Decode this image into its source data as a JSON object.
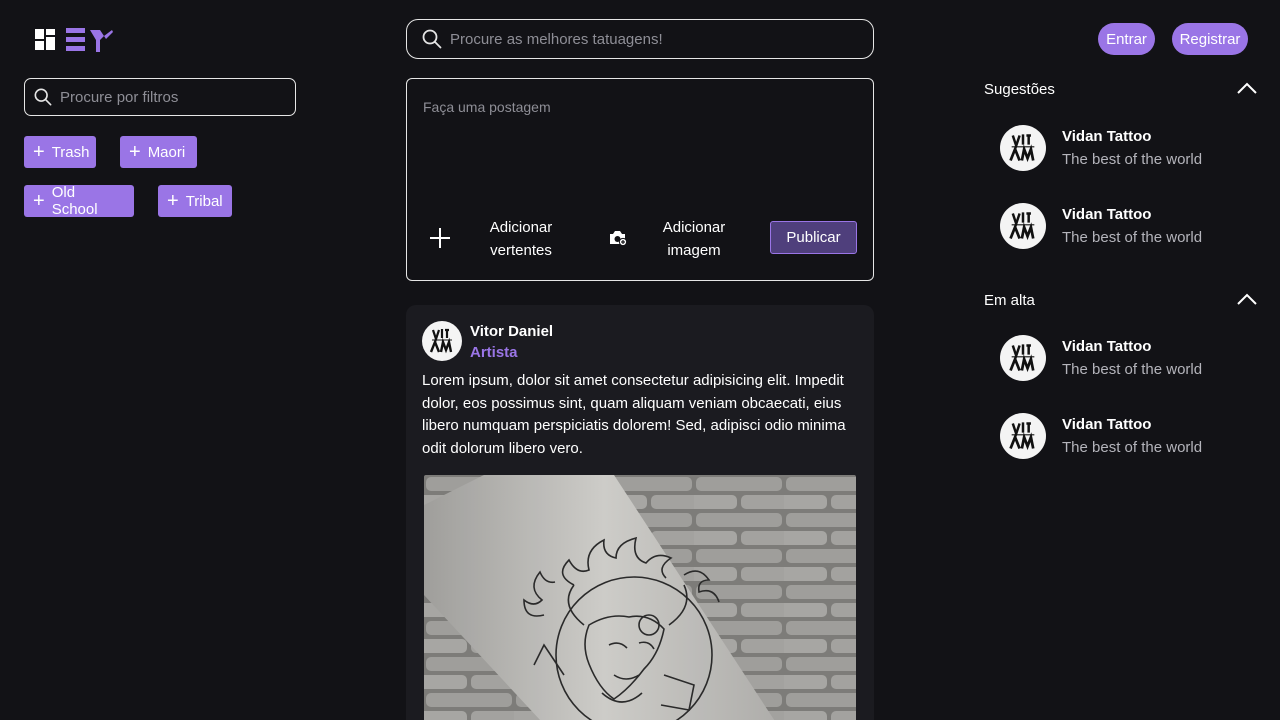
{
  "header": {
    "search_placeholder": "Procure as melhores tatuagens!",
    "login_label": "Entrar",
    "register_label": "Registrar"
  },
  "filters": {
    "search_placeholder": "Procure por filtros",
    "tags": [
      "Trash",
      "Maori",
      "Old School",
      "Tribal"
    ]
  },
  "composer": {
    "placeholder": "Faça uma postagem",
    "add_styles_label": "Adicionar\nvertentes",
    "add_image_label": "Adicionar\nimagem",
    "publish_label": "Publicar"
  },
  "post": {
    "author": "Vitor Daniel",
    "role": "Artista",
    "text": "Lorem ipsum, dolor sit amet consectetur adipisicing elit. Impedit dolor, eos possimus sint, quam aliquam veniam obcaecati, eius libero numquam perspiciatis dolorem! Sed, adipisci odio minima odit dolorum libero vero."
  },
  "suggestions": {
    "title": "Sugestões",
    "items": [
      {
        "name": "Vidan Tattoo",
        "desc": "The best of the world"
      },
      {
        "name": "Vidan Tattoo",
        "desc": "The best of the world"
      }
    ]
  },
  "trending": {
    "title": "Em alta",
    "items": [
      {
        "name": "Vidan Tattoo",
        "desc": "The best of the world"
      },
      {
        "name": "Vidan Tattoo",
        "desc": "The best of the world"
      }
    ]
  },
  "colors": {
    "background": "#121216",
    "accent": "#9a75e6",
    "publish_bg": "#4f3f7c",
    "card": "#1b1b20"
  }
}
